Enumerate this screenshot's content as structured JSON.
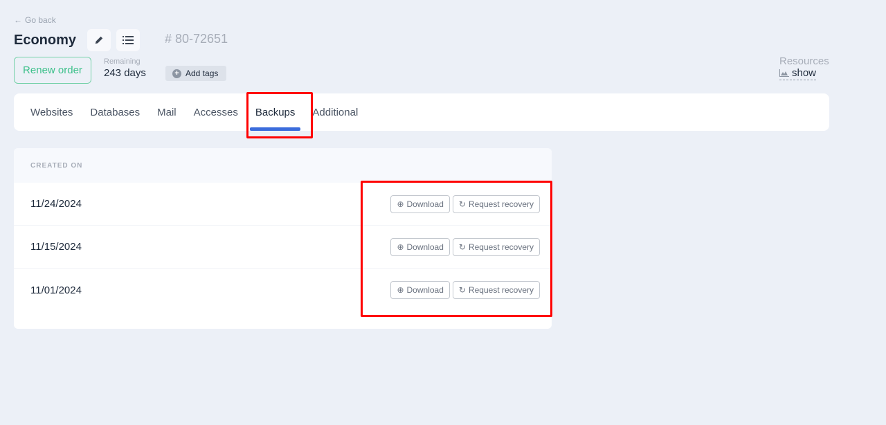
{
  "header": {
    "go_back": "Go back",
    "title": "Economy",
    "order_id": "# 80-72651",
    "renew_label": "Renew order",
    "remaining_label": "Remaining",
    "remaining_value": "243 days",
    "add_tags_label": "Add tags",
    "resources_label": "Resources",
    "resources_show": "show"
  },
  "tabs": [
    {
      "label": "Websites",
      "active": false
    },
    {
      "label": "Databases",
      "active": false
    },
    {
      "label": "Mail",
      "active": false
    },
    {
      "label": "Accesses",
      "active": false
    },
    {
      "label": "Backups",
      "active": true
    },
    {
      "label": "Additional",
      "active": false
    }
  ],
  "table": {
    "column_header": "CREATED ON",
    "download_label": "Download",
    "recovery_label": "Request recovery",
    "rows": [
      {
        "date": "11/24/2024"
      },
      {
        "date": "11/15/2024"
      },
      {
        "date": "11/01/2024"
      }
    ]
  },
  "colors": {
    "accent": "#3b6cdc",
    "renew": "#3cc08a",
    "highlight": "#ff0000"
  }
}
